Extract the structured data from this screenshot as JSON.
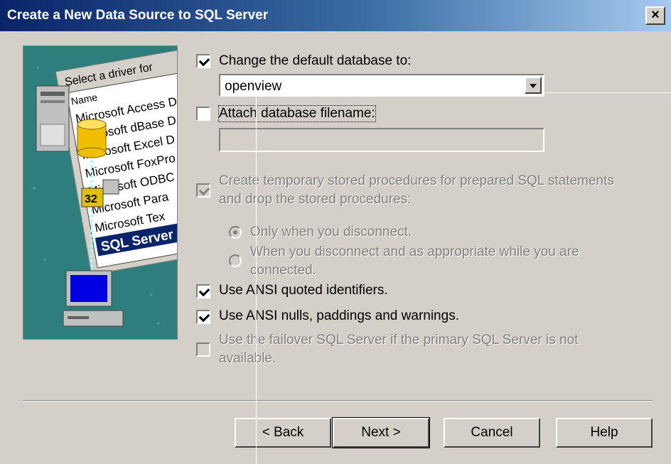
{
  "window": {
    "title": "Create a New Data Source to SQL Server",
    "close_label": "×"
  },
  "illustration": {
    "select_text": "Select a driver for",
    "name_header": "Name",
    "drivers": [
      "Microsoft Access D",
      "Microsoft dBase D",
      "Microsoft Excel D",
      "Microsoft FoxPro",
      "Microsoft ODBC",
      "Microsoft Para",
      "Microsoft Tex",
      "SQL Server"
    ],
    "badge": "32"
  },
  "options": {
    "change_default_db": {
      "label": "Change the default database to:",
      "checked": true
    },
    "default_db_value": "openview",
    "attach_db": {
      "label": "Attach database filename:",
      "checked": false
    },
    "attach_filename_value": "",
    "create_temp_procs": {
      "label_line1": "Create temporary stored procedures for prepared SQL statements",
      "label_line2": "and drop the stored procedures:",
      "checked": true,
      "enabled": false
    },
    "radio_only_disconnect": {
      "label": "Only when you disconnect.",
      "selected": true
    },
    "radio_disconnect_appropriate": {
      "label_line1": "When you disconnect and as appropriate while you are",
      "label_line2": "connected.",
      "selected": false
    },
    "ansi_quoted": {
      "label": "Use ANSI quoted identifiers.",
      "checked": true
    },
    "ansi_nulls": {
      "label": "Use ANSI nulls, paddings and warnings.",
      "checked": true
    },
    "failover": {
      "label_line1": "Use the failover SQL Server if the primary SQL Server is not",
      "label_line2": "available.",
      "checked": false,
      "enabled": false
    }
  },
  "buttons": {
    "back": "< Back",
    "next": "Next >",
    "cancel": "Cancel",
    "help": "Help"
  },
  "colors": {
    "face": "#d4d0c8",
    "title_start": "#0a246a",
    "title_end": "#a6caf0",
    "art_bg": "#2f7e7e",
    "selected": "#0a246a"
  }
}
